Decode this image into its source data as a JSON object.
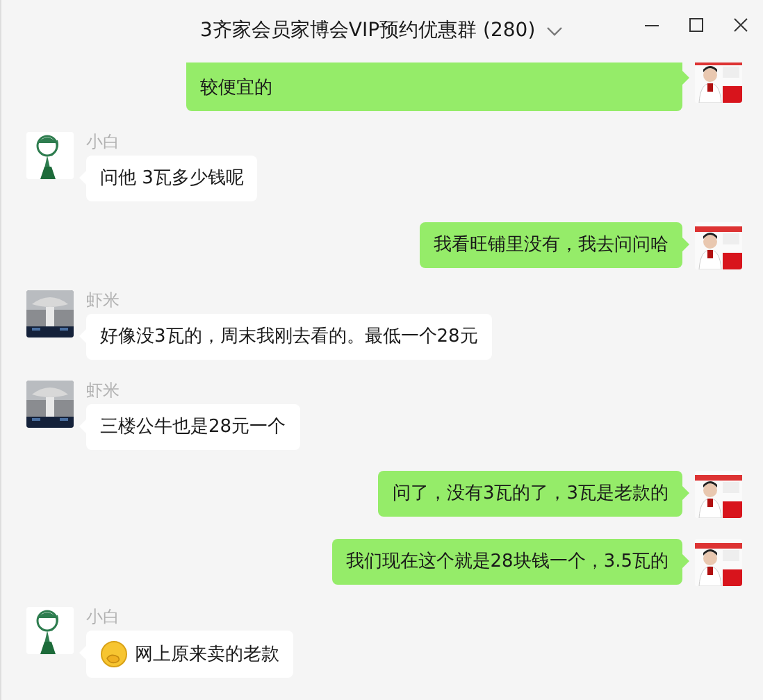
{
  "window": {
    "title": "3齐家会员家博会VIP预约优惠群 (280)"
  },
  "messages": [
    {
      "kind": "sent",
      "text": "较便宜的"
    },
    {
      "kind": "received",
      "sender": "小白",
      "text": "问他 3瓦多少钱呢"
    },
    {
      "kind": "sent",
      "text": "我看旺铺里没有，我去问问哈"
    },
    {
      "kind": "received",
      "sender": "虾米",
      "text": "好像没3瓦的，周末我刚去看的。最低一个28元"
    },
    {
      "kind": "received",
      "sender": "虾米",
      "text": "三楼公牛也是28元一个"
    },
    {
      "kind": "sent",
      "text": "问了，没有3瓦的了，3瓦是老款的"
    },
    {
      "kind": "sent",
      "text": "我们现在这个就是28块钱一个，3.5瓦的"
    },
    {
      "kind": "received",
      "sender": "小白",
      "text": "网上原来卖的老款",
      "emoji": true
    }
  ]
}
